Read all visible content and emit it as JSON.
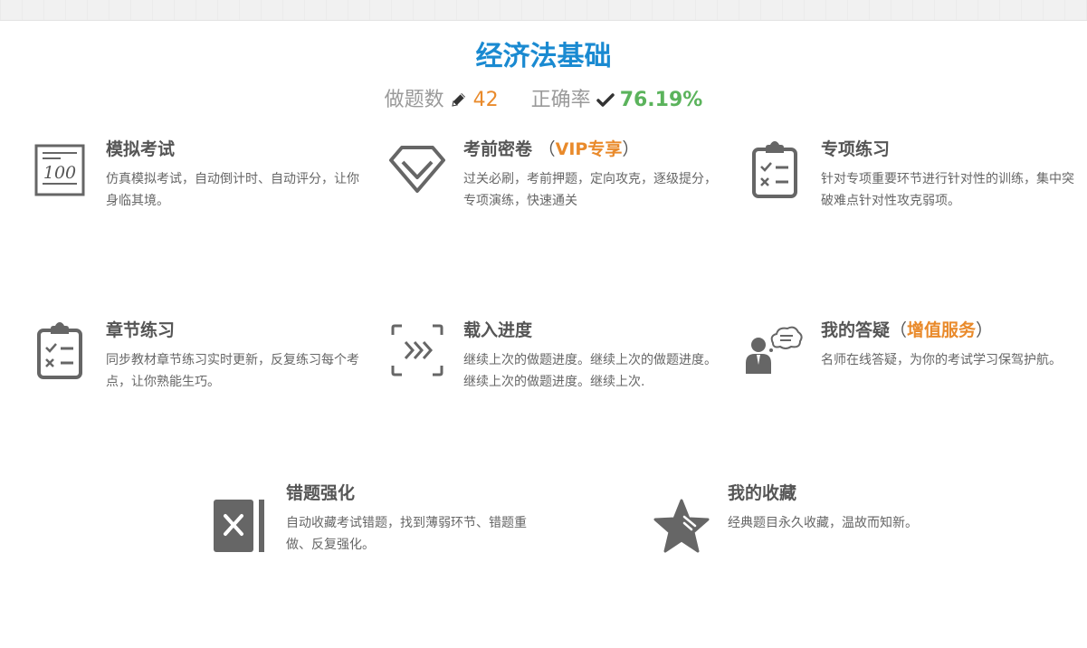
{
  "header": {
    "title": "经济法基础",
    "done_label": "做题数",
    "done_count": "42",
    "rate_label": "正确率",
    "rate_value": "76.19%"
  },
  "cards": [
    {
      "title": "模拟考试",
      "desc": "仿真模拟考试，自动倒计时、自动评分，让你身临其境。",
      "icon": "exam-score-100-icon"
    },
    {
      "title": "考前密卷",
      "paren_open": "（",
      "tag": "VIP专享",
      "paren_close": "）",
      "desc": "过关必刷，考前押题，定向攻克，逐级提分，专项演练，快速通关",
      "icon": "diamond-icon"
    },
    {
      "title": "专项练习",
      "desc": "针对专项重要环节进行针对性的训练，集中突破难点针对性攻克弱项。",
      "icon": "clipboard-checklist-icon"
    },
    {
      "title": "章节练习",
      "desc": "同步教材章节练习实时更新，反复练习每个考点，让你熟能生巧。",
      "icon": "clipboard-checklist-icon"
    },
    {
      "title": "载入进度",
      "desc": "继续上次的做题进度。继续上次的做题进度。继续上次的做题进度。继续上次.",
      "icon": "forward-arrows-icon"
    },
    {
      "title": "我的答疑",
      "paren_open": "（",
      "tag": "增值服务",
      "paren_close": "）",
      "desc": "名师在线答疑，为你的考试学习保驾护航。",
      "icon": "teacher-chat-icon"
    },
    {
      "title": "错题强化",
      "desc": "自动收藏考试错题，找到薄弱环节、错题重做、反复强化。",
      "icon": "wrong-book-icon"
    },
    {
      "title": "我的收藏",
      "desc": "经典题目永久收藏，温故而知新。",
      "icon": "star-icon"
    }
  ],
  "colors": {
    "title_blue": "#1a8ad1",
    "orange": "#e98a2b",
    "green": "#5bb35c",
    "icon_gray": "#666666"
  }
}
